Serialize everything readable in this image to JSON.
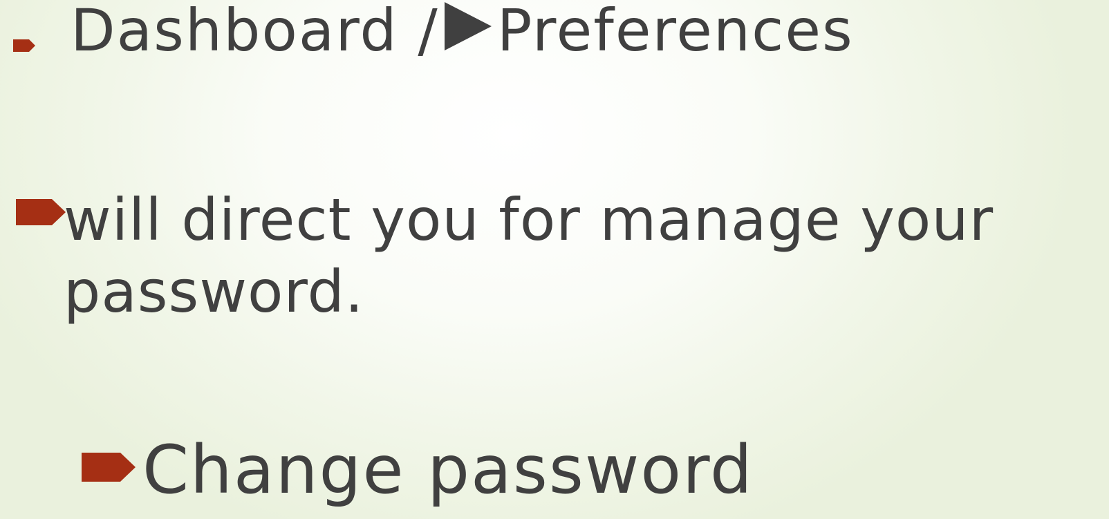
{
  "breadcrumb": {
    "part1": "Dashboard /",
    "part2": "Preferences",
    "separator_icon": "play-triangle-icon"
  },
  "paragraph": {
    "text": "will direct you for manage your password."
  },
  "subitem": {
    "text": "Change password"
  },
  "colors": {
    "bullet": "#a52f14",
    "text": "#404040",
    "background_center": "#ffffff",
    "background_edge": "#eaf1dd"
  }
}
